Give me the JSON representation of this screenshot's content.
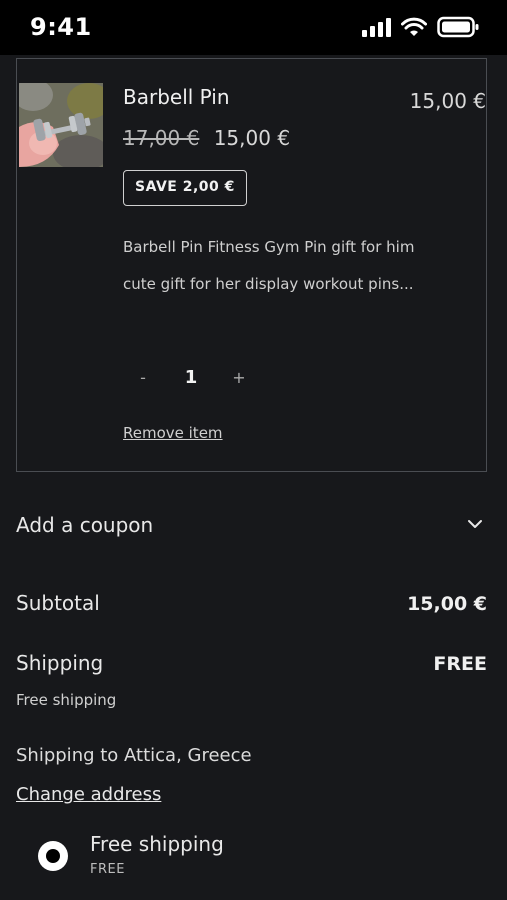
{
  "status_bar": {
    "time": "9:41"
  },
  "cart_item": {
    "name": "Barbell Pin",
    "line_total": "15,00 €",
    "price_original": "17,00 €",
    "price_sale": "15,00 €",
    "save_badge": "SAVE 2,00 €",
    "description": "Barbell Pin Fitness Gym Pin gift for him cute gift for her display workout pins...",
    "quantity": "1",
    "qty_minus": "-",
    "qty_plus": "+",
    "remove_label": "Remove item"
  },
  "coupon": {
    "label": "Add a coupon"
  },
  "summary": {
    "subtotal_label": "Subtotal",
    "subtotal_value": "15,00 €",
    "shipping_label": "Shipping",
    "shipping_value": "FREE",
    "shipping_note": "Free shipping",
    "ship_to": "Shipping to Attica, Greece",
    "change_address": "Change address"
  },
  "shipping_option": {
    "label": "Free shipping",
    "price": "FREE",
    "selected": true
  },
  "colors": {
    "background": "#17181b",
    "status_bar": "#000000",
    "border": "#4a4d52",
    "text": "#e8e8e8"
  },
  "icons": [
    "cellular-signal-icon",
    "wifi-icon",
    "battery-icon",
    "chevron-down-icon",
    "radio-selected-icon"
  ]
}
